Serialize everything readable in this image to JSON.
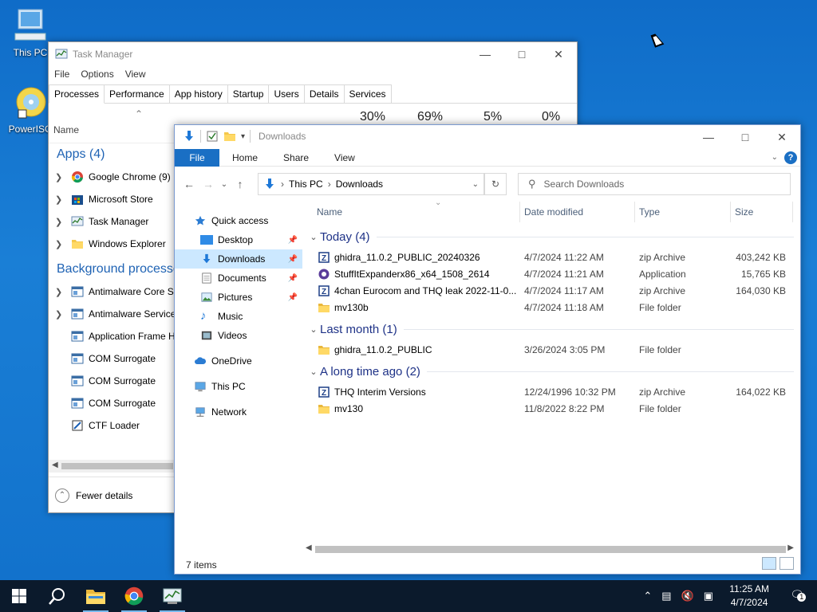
{
  "desktop": {
    "icons": [
      {
        "label": "This PC"
      },
      {
        "label": "PowerISO"
      }
    ]
  },
  "task_manager": {
    "title": "Task Manager",
    "menu": [
      "File",
      "Options",
      "View"
    ],
    "tabs": [
      "Processes",
      "Performance",
      "App history",
      "Startup",
      "Users",
      "Details",
      "Services"
    ],
    "active_tab": "Processes",
    "name_header": "Name",
    "percents": [
      "30%",
      "69%",
      "5%",
      "0%"
    ],
    "apps_group": "Apps (4)",
    "apps": [
      {
        "label": "Google Chrome (9)",
        "icon": "chrome-icon"
      },
      {
        "label": "Microsoft Store",
        "icon": "store-icon"
      },
      {
        "label": "Task Manager",
        "icon": "task-manager-icon"
      },
      {
        "label": "Windows Explorer",
        "icon": "folder-icon"
      }
    ],
    "bg_group": "Background processes",
    "bg": [
      {
        "label": "Antimalware Core Se",
        "expand": true
      },
      {
        "label": "Antimalware Service",
        "expand": true
      },
      {
        "label": "Application Frame H",
        "expand": false
      },
      {
        "label": "COM Surrogate",
        "expand": false
      },
      {
        "label": "COM Surrogate",
        "expand": false
      },
      {
        "label": "COM Surrogate",
        "expand": false
      },
      {
        "label": "CTF Loader",
        "expand": false
      }
    ],
    "fewer_details": "Fewer details"
  },
  "explorer": {
    "title": "Downloads",
    "ribbon": {
      "file": "File",
      "tabs": [
        "Home",
        "Share",
        "View"
      ]
    },
    "breadcrumb": [
      "This PC",
      "Downloads"
    ],
    "search_placeholder": "Search Downloads",
    "nav": [
      {
        "label": "Quick access",
        "icon": "star-icon",
        "indent": 0,
        "pin": false,
        "sel": false
      },
      {
        "label": "Desktop",
        "icon": "desktop-icon",
        "indent": 1,
        "pin": true,
        "sel": false
      },
      {
        "label": "Downloads",
        "icon": "download-icon",
        "indent": 1,
        "pin": true,
        "sel": true
      },
      {
        "label": "Documents",
        "icon": "documents-icon",
        "indent": 1,
        "pin": true,
        "sel": false
      },
      {
        "label": "Pictures",
        "icon": "pictures-icon",
        "indent": 1,
        "pin": true,
        "sel": false
      },
      {
        "label": "Music",
        "icon": "music-icon",
        "indent": 1,
        "pin": false,
        "sel": false
      },
      {
        "label": "Videos",
        "icon": "videos-icon",
        "indent": 1,
        "pin": false,
        "sel": false
      },
      {
        "label": "OneDrive",
        "icon": "cloud-icon",
        "indent": 0,
        "pin": false,
        "sel": false
      },
      {
        "label": "This PC",
        "icon": "computer-icon",
        "indent": 0,
        "pin": false,
        "sel": false
      },
      {
        "label": "Network",
        "icon": "network-icon",
        "indent": 0,
        "pin": false,
        "sel": false
      }
    ],
    "columns": [
      "Name",
      "Date modified",
      "Type",
      "Size"
    ],
    "groups": [
      {
        "label": "Today (4)",
        "files": [
          {
            "name": "ghidra_11.0.2_PUBLIC_20240326",
            "date": "4/7/2024 11:22 AM",
            "type": "zip Archive",
            "size": "403,242 KB",
            "icon": "zip"
          },
          {
            "name": "StuffItExpanderx86_x64_1508_2614",
            "date": "4/7/2024 11:21 AM",
            "type": "Application",
            "size": "15,765 KB",
            "icon": "app"
          },
          {
            "name": "4chan Eurocom and THQ leak 2022-11-0...",
            "date": "4/7/2024 11:17 AM",
            "type": "zip Archive",
            "size": "164,030 KB",
            "icon": "zip"
          },
          {
            "name": "mv130b",
            "date": "4/7/2024 11:18 AM",
            "type": "File folder",
            "size": "",
            "icon": "folder"
          }
        ]
      },
      {
        "label": "Last month (1)",
        "files": [
          {
            "name": "ghidra_11.0.2_PUBLIC",
            "date": "3/26/2024 3:05 PM",
            "type": "File folder",
            "size": "",
            "icon": "folder"
          }
        ]
      },
      {
        "label": "A long time ago (2)",
        "files": [
          {
            "name": "THQ Interim Versions",
            "date": "12/24/1996 10:32 PM",
            "type": "zip Archive",
            "size": "164,022 KB",
            "icon": "zip"
          },
          {
            "name": "mv130",
            "date": "11/8/2022 8:22 PM",
            "type": "File folder",
            "size": "",
            "icon": "folder"
          }
        ]
      }
    ],
    "status": "7 items"
  },
  "taskbar": {
    "time": "11:25 AM",
    "date": "4/7/2024",
    "notifications": "1"
  }
}
